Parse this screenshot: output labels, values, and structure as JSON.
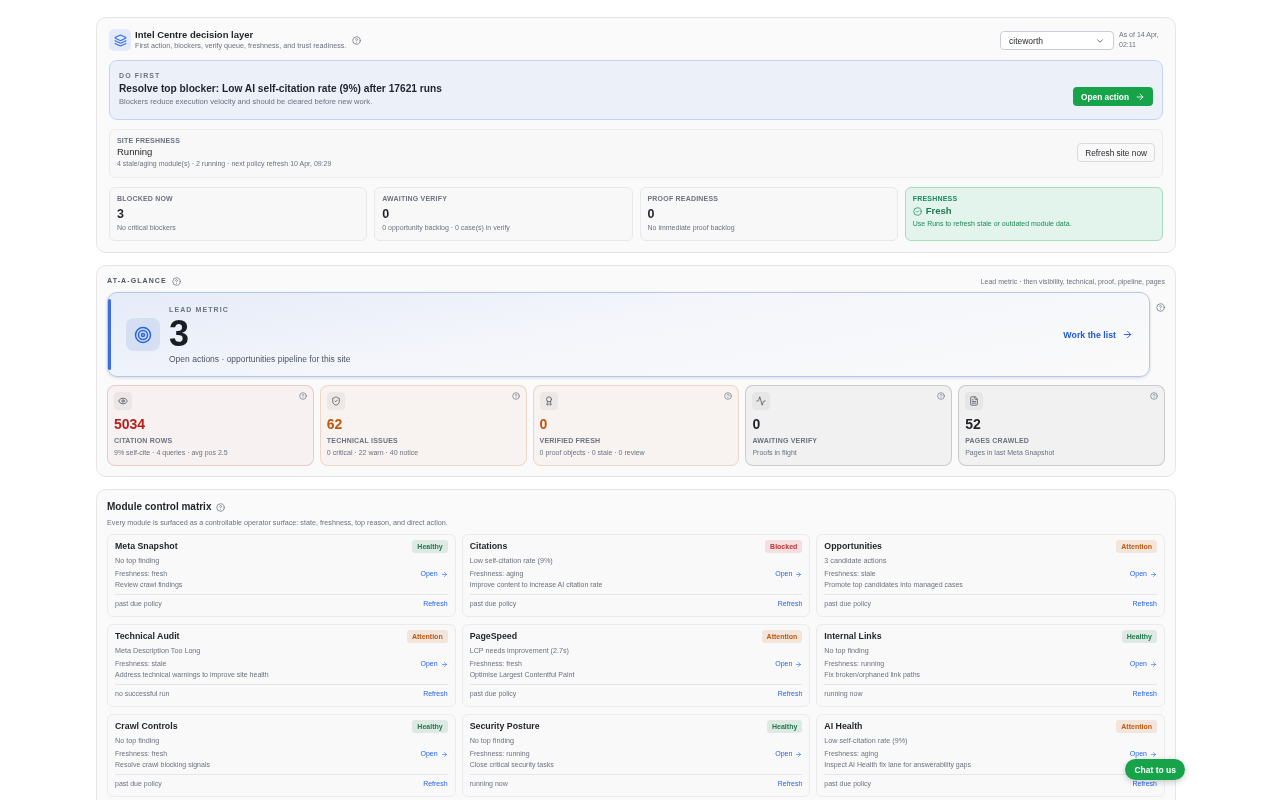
{
  "header": {
    "title": "Intel Centre decision layer",
    "subtitle": "First action, blockers, verify queue, freshness, and trust readiness.",
    "site_select": {
      "value": "citeworth"
    },
    "as_of": "As of 14 Apr, 02:11"
  },
  "do_first": {
    "label": "DO FIRST",
    "title": "Resolve top blocker: Low AI self-citation rate (9%) after 17621 runs",
    "subtitle": "Blockers reduce execution velocity and should be cleared before new work.",
    "button": "Open action"
  },
  "site_freshness": {
    "label": "SITE FRESHNESS",
    "state": "Running",
    "detail": "4 stale/aging module(s) · 2 running · next policy refresh 10 Apr, 09:29",
    "button": "Refresh site now"
  },
  "stats": [
    {
      "kind": "count",
      "label": "BLOCKED NOW",
      "value": "3",
      "detail": "No critical blockers"
    },
    {
      "kind": "count",
      "label": "AWAITING VERIFY",
      "value": "0",
      "detail": "0 opportunity backlog · 0 case(s) in verify"
    },
    {
      "kind": "count",
      "label": "PROOF READINESS",
      "value": "0",
      "detail": "No immediate proof backlog"
    },
    {
      "kind": "status",
      "label": "FRESHNESS",
      "value": "Fresh",
      "detail": "Use Runs to refresh stale or outdated module data."
    }
  ],
  "at_a_glance": {
    "title": "AT-A-GLANCE",
    "note": "Lead metric · then visibility, technical, proof, pipeline, pages",
    "lead": {
      "label": "LEAD METRIC",
      "value": "3",
      "caption": "Open actions · opportunities pipeline for this site",
      "link": "Work the list"
    },
    "metrics": [
      {
        "value": "5034",
        "label": "CITATION ROWS",
        "detail": "9% self-cite · 4 queries · avg pos 2.5",
        "color": "#b91c1c"
      },
      {
        "value": "62",
        "label": "TECHNICAL ISSUES",
        "detail": "0 critical · 22 warn · 40 notice",
        "color": "#c2570c"
      },
      {
        "value": "0",
        "label": "VERIFIED FRESH",
        "detail": "0 proof objects · 0 stale · 0 review",
        "color": "#c2570c"
      },
      {
        "value": "0",
        "label": "AWAITING VERIFY",
        "detail": "Proofs in flight",
        "color": "#1f2328"
      },
      {
        "value": "52",
        "label": "PAGES CRAWLED",
        "detail": "Pages in last Meta Snapshot",
        "color": "#1f2328"
      }
    ]
  },
  "modules": {
    "title": "Module control matrix",
    "subtitle": "Every module is surfaced as a controllable operator surface: state, freshness, top reason, and direct action.",
    "items": [
      {
        "name": "Meta Snapshot",
        "badge": {
          "label": "Healthy",
          "color": "#1f7a4f"
        },
        "finding": "No top finding",
        "freshness": "Freshness: fresh",
        "open": "Open",
        "next_step": "Review crawl findings",
        "footer": "past due policy",
        "refresh": "Refresh"
      },
      {
        "name": "Citations",
        "badge": {
          "label": "Blocked",
          "color": "#c53030"
        },
        "finding": "Low self-citation rate (9%)",
        "freshness": "Freshness: aging",
        "open": "Open",
        "next_step": "Improve content to increase AI citation rate",
        "footer": "past due policy",
        "refresh": "Refresh"
      },
      {
        "name": "Opportunities",
        "badge": {
          "label": "Attention",
          "color": "#c05a10"
        },
        "finding": "3 candidate actions",
        "freshness": "Freshness: stale",
        "open": "Open",
        "next_step": "Promote top candidates into managed cases",
        "footer": "past due policy",
        "refresh": "Refresh"
      },
      {
        "name": "Technical Audit",
        "badge": {
          "label": "Attention",
          "color": "#c05a10"
        },
        "finding": "Meta Description Too Long",
        "freshness": "Freshness: stale",
        "open": "Open",
        "next_step": "Address technical warnings to improve site health",
        "footer": "no successful run",
        "refresh": "Refresh"
      },
      {
        "name": "PageSpeed",
        "badge": {
          "label": "Attention",
          "color": "#c05a10"
        },
        "finding": "LCP needs improvement (2.7s)",
        "freshness": "Freshness: fresh",
        "open": "Open",
        "next_step": "Optimise Largest Contentful Paint",
        "footer": "past due policy",
        "refresh": "Refresh"
      },
      {
        "name": "Internal Links",
        "badge": {
          "label": "Healthy",
          "color": "#1f7a4f"
        },
        "finding": "No top finding",
        "freshness": "Freshness: running",
        "open": "Open",
        "next_step": "Fix broken/orphaned link paths",
        "footer": "running now",
        "refresh": "Refresh"
      },
      {
        "name": "Crawl Controls",
        "badge": {
          "label": "Healthy",
          "color": "#1f7a4f"
        },
        "finding": "No top finding",
        "freshness": "Freshness: fresh",
        "open": "Open",
        "next_step": "Resolve crawl blocking signals",
        "footer": "past due policy",
        "refresh": "Refresh"
      },
      {
        "name": "Security Posture",
        "badge": {
          "label": "Healthy",
          "color": "#1f7a4f"
        },
        "finding": "No top finding",
        "freshness": "Freshness: running",
        "open": "Open",
        "next_step": "Close critical security tasks",
        "footer": "running now",
        "refresh": "Refresh"
      },
      {
        "name": "AI Health",
        "badge": {
          "label": "Attention",
          "color": "#c05a10"
        },
        "finding": "Low self-citation rate (9%)",
        "freshness": "Freshness: aging",
        "open": "Open",
        "next_step": "Inspect AI Health fix lane for answerability gaps",
        "footer": "past due policy",
        "refresh": "Refresh"
      }
    ]
  },
  "chat_button": "Chat to us"
}
